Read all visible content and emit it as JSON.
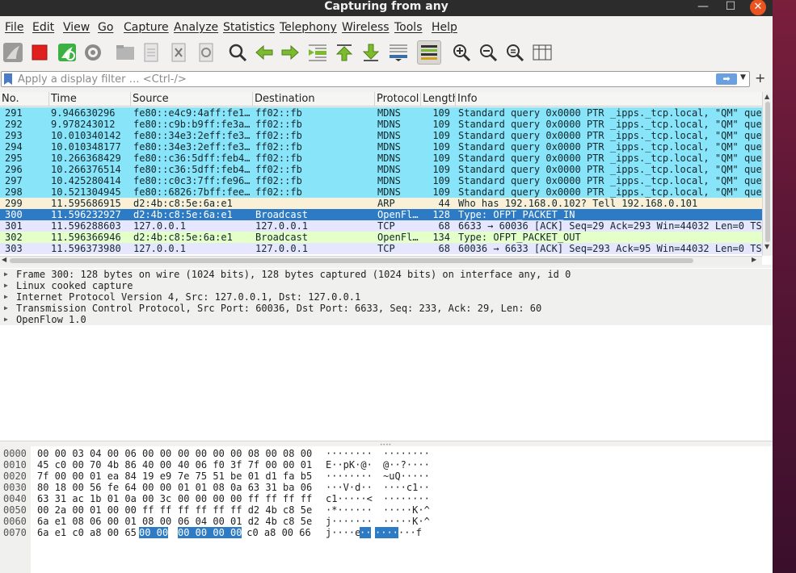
{
  "window": {
    "title": "Capturing from any"
  },
  "titlebar_controls": {
    "minimize": "—",
    "maximize": "☐",
    "close": "✕"
  },
  "menu": [
    {
      "label": "File"
    },
    {
      "label": "Edit"
    },
    {
      "label": "View"
    },
    {
      "label": "Go"
    },
    {
      "label": "Capture"
    },
    {
      "label": "Analyze"
    },
    {
      "label": "Statistics"
    },
    {
      "label": "Telephony"
    },
    {
      "label": "Wireless"
    },
    {
      "label": "Tools"
    },
    {
      "label": "Help"
    }
  ],
  "toolbar": [
    {
      "icon": "shark-fin-start-icon"
    },
    {
      "icon": "stop-capture-icon"
    },
    {
      "icon": "restart-capture-icon"
    },
    {
      "icon": "capture-options-icon"
    },
    {
      "icon": "open-file-icon"
    },
    {
      "icon": "save-file-icon"
    },
    {
      "icon": "close-file-icon"
    },
    {
      "icon": "reload-file-icon"
    },
    {
      "icon": "find-packet-icon"
    },
    {
      "icon": "go-back-icon"
    },
    {
      "icon": "go-forward-icon"
    },
    {
      "icon": "go-to-packet-icon"
    },
    {
      "icon": "go-first-icon"
    },
    {
      "icon": "go-last-icon"
    },
    {
      "icon": "autoscroll-icon"
    },
    {
      "icon": "colorize-icon"
    },
    {
      "icon": "zoom-in-icon"
    },
    {
      "icon": "zoom-out-icon"
    },
    {
      "icon": "zoom-normal-icon"
    },
    {
      "icon": "resize-columns-icon"
    }
  ],
  "filter": {
    "placeholder": "Apply a display filter … <Ctrl-/>",
    "apply_glyph": "➡",
    "dropdown_glyph": "▼",
    "plus_glyph": "+"
  },
  "colors": {
    "mdns": "#88e4f8",
    "arp": "#faf0d7",
    "openflow": "#e4ffc7",
    "tcp": "#e7e6ff",
    "selected": "#2d7bc4",
    "close_button": "#e95420"
  },
  "packet_list": {
    "columns": [
      "No.",
      "Time",
      "Source",
      "Destination",
      "Protocol",
      "Length",
      "Info"
    ],
    "rows": [
      {
        "no": "291",
        "time": "9.946630296",
        "src": "fe80::e4c9:4aff:fe1…",
        "dst": "ff02::fb",
        "proto": "MDNS",
        "len": "109",
        "info": "Standard query 0x0000 PTR _ipps._tcp.local, \"QM\" que",
        "kind": "mdns"
      },
      {
        "no": "292",
        "time": "9.978243012",
        "src": "fe80::c9b:b9ff:fe3a…",
        "dst": "ff02::fb",
        "proto": "MDNS",
        "len": "109",
        "info": "Standard query 0x0000 PTR _ipps._tcp.local, \"QM\" que",
        "kind": "mdns"
      },
      {
        "no": "293",
        "time": "10.010340142",
        "src": "fe80::34e3:2eff:fe3…",
        "dst": "ff02::fb",
        "proto": "MDNS",
        "len": "109",
        "info": "Standard query 0x0000 PTR _ipps._tcp.local, \"QM\" que",
        "kind": "mdns"
      },
      {
        "no": "294",
        "time": "10.010348177",
        "src": "fe80::34e3:2eff:fe3…",
        "dst": "ff02::fb",
        "proto": "MDNS",
        "len": "109",
        "info": "Standard query 0x0000 PTR _ipps._tcp.local, \"QM\" que",
        "kind": "mdns"
      },
      {
        "no": "295",
        "time": "10.266368429",
        "src": "fe80::c36:5dff:feb4…",
        "dst": "ff02::fb",
        "proto": "MDNS",
        "len": "109",
        "info": "Standard query 0x0000 PTR _ipps._tcp.local, \"QM\" que",
        "kind": "mdns"
      },
      {
        "no": "296",
        "time": "10.266376514",
        "src": "fe80::c36:5dff:feb4…",
        "dst": "ff02::fb",
        "proto": "MDNS",
        "len": "109",
        "info": "Standard query 0x0000 PTR _ipps._tcp.local, \"QM\" que",
        "kind": "mdns"
      },
      {
        "no": "297",
        "time": "10.425280414",
        "src": "fe80::c0c3:7ff:fe96…",
        "dst": "ff02::fb",
        "proto": "MDNS",
        "len": "109",
        "info": "Standard query 0x0000 PTR _ipps._tcp.local, \"QM\" que",
        "kind": "mdns"
      },
      {
        "no": "298",
        "time": "10.521304945",
        "src": "fe80::6826:7bff:fee…",
        "dst": "ff02::fb",
        "proto": "MDNS",
        "len": "109",
        "info": "Standard query 0x0000 PTR _ipps._tcp.local, \"QM\" que",
        "kind": "mdns"
      },
      {
        "no": "299",
        "time": "11.595686915",
        "src": "d2:4b:c8:5e:6a:e1",
        "dst": "",
        "proto": "ARP",
        "len": "44",
        "info": "Who has 192.168.0.102? Tell 192.168.0.101",
        "kind": "arp"
      },
      {
        "no": "300",
        "time": "11.596232927",
        "src": "d2:4b:c8:5e:6a:e1",
        "dst": "Broadcast",
        "proto": "OpenFl…",
        "len": "128",
        "info": "Type: OFPT_PACKET_IN",
        "kind": "selected"
      },
      {
        "no": "301",
        "time": "11.596288603",
        "src": "127.0.0.1",
        "dst": "127.0.0.1",
        "proto": "TCP",
        "len": "68",
        "info": "6633 → 60036 [ACK] Seq=29 Ack=293 Win=44032 Len=0 TS",
        "kind": "tcp"
      },
      {
        "no": "302",
        "time": "11.596366946",
        "src": "d2:4b:c8:5e:6a:e1",
        "dst": "Broadcast",
        "proto": "OpenFl…",
        "len": "134",
        "info": "Type: OFPT_PACKET_OUT",
        "kind": "openflow"
      },
      {
        "no": "303",
        "time": "11.596373980",
        "src": "127.0.0.1",
        "dst": "127.0.0.1",
        "proto": "TCP",
        "len": "68",
        "info": "60036 → 6633 [ACK] Seq=293 Ack=95 Win=44032 Len=0 TS",
        "kind": "tcp"
      }
    ]
  },
  "details": [
    "Frame 300: 128 bytes on wire (1024 bits), 128 bytes captured (1024 bits) on interface any, id 0",
    "Linux cooked capture",
    "Internet Protocol Version 4, Src: 127.0.0.1, Dst: 127.0.0.1",
    "Transmission Control Protocol, Src Port: 60036, Dst Port: 6633, Seq: 233, Ack: 29, Len: 60",
    "OpenFlow 1.0"
  ],
  "bytes": [
    {
      "off": "0000",
      "hex1": "00 00 03 04 00 06 00 00",
      "hex2": "00 00 00 00 08 00 08 00",
      "asc1": "········",
      "asc2": "········"
    },
    {
      "off": "0010",
      "hex1": "45 c0 00 70 4b 86 40 00",
      "hex2": "40 06 f0 3f 7f 00 00 01",
      "asc1": "E··pK·@·",
      "asc2": "@··?····"
    },
    {
      "off": "0020",
      "hex1": "7f 00 00 01 ea 84 19 e9",
      "hex2": "7e 75 51 be 01 d1 fa b5",
      "asc1": "········",
      "asc2": "~uQ·····"
    },
    {
      "off": "0030",
      "hex1": "80 18 00 56 fe 64 00 00",
      "hex2": "01 01 08 0a 63 31 ba 06",
      "asc1": "···V·d··",
      "asc2": "····c1··"
    },
    {
      "off": "0040",
      "hex1": "63 31 ac 1b 01 0a 00 3c",
      "hex2": "00 00 00 00 ff ff ff ff",
      "asc1": "c1·····<",
      "asc2": "········"
    },
    {
      "off": "0050",
      "hex1": "00 2a 00 01 00 00 ff ff",
      "hex2": "ff ff ff ff d2 4b c8 5e",
      "asc1": "·*······",
      "asc2": "·····K·^"
    },
    {
      "off": "0060",
      "hex1": "6a e1 08 06 00 01 08 00",
      "hex2": "06 04 00 01 d2 4b c8 5e",
      "asc1": "j·······",
      "asc2": "·····K·^"
    },
    {
      "off": "0070",
      "hex1a": "6a e1 c0 a8 00 65 ",
      "hex1b": "00 00",
      "hex2a": "00 00 00 00",
      "hex2b": " c0 a8 00 66",
      "asc1a": "j····e",
      "asc1b": "··",
      "asc2a": "····",
      "asc2b": "···f"
    }
  ]
}
